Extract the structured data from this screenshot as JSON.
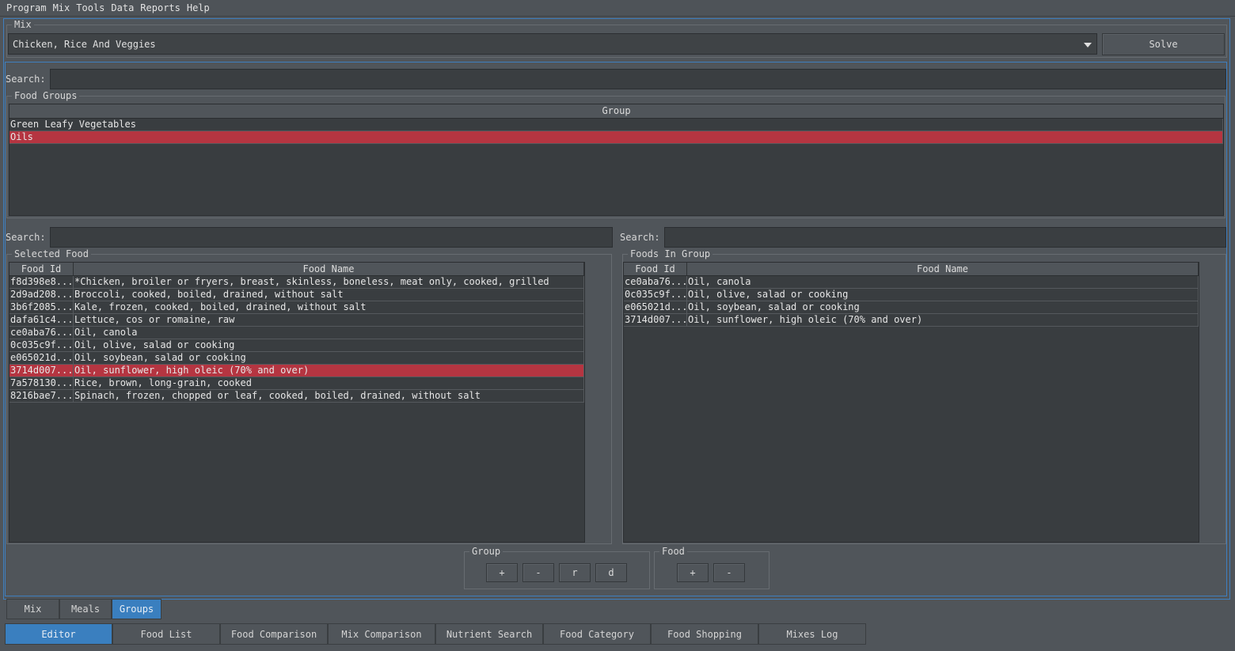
{
  "menu": [
    "Program",
    "Mix",
    "Tools",
    "Data",
    "Reports",
    "Help"
  ],
  "mix": {
    "title": "Mix",
    "selected": "Chicken, Rice And Veggies",
    "solve_label": "Solve"
  },
  "groups_search": {
    "label": "Search:",
    "value": ""
  },
  "food_groups": {
    "title": "Food Groups",
    "column": "Group",
    "rows": [
      "Green Leafy Vegetables",
      "Oils"
    ],
    "selected_index": 1
  },
  "left_search": {
    "label": "Search:",
    "value": ""
  },
  "right_search": {
    "label": "Search:",
    "value": ""
  },
  "selected_food": {
    "title": "Selected Food",
    "columns": [
      "Food Id",
      "Food Name"
    ],
    "rows": [
      [
        "f8d398e8...",
        "*Chicken, broiler or fryers, breast, skinless, boneless, meat only, cooked, grilled"
      ],
      [
        "2d9ad208...",
        "Broccoli, cooked, boiled, drained, without salt"
      ],
      [
        "3b6f2085...",
        "Kale, frozen, cooked, boiled, drained, without salt"
      ],
      [
        "dafa61c4...",
        "Lettuce, cos or romaine, raw"
      ],
      [
        "ce0aba76...",
        "Oil, canola"
      ],
      [
        "0c035c9f...",
        "Oil, olive, salad or cooking"
      ],
      [
        "e065021d...",
        "Oil, soybean, salad or cooking"
      ],
      [
        "3714d007...",
        "Oil, sunflower, high oleic (70% and over)"
      ],
      [
        "7a578130...",
        "Rice, brown, long-grain, cooked"
      ],
      [
        "8216bae7...",
        "Spinach, frozen, chopped or leaf, cooked, boiled, drained, without salt"
      ]
    ],
    "selected_index": 7
  },
  "foods_in_group": {
    "title": "Foods In Group",
    "columns": [
      "Food Id",
      "Food Name"
    ],
    "rows": [
      [
        "ce0aba76...",
        "Oil, canola"
      ],
      [
        "0c035c9f...",
        "Oil, olive, salad or cooking"
      ],
      [
        "e065021d...",
        "Oil, soybean, salad or cooking"
      ],
      [
        "3714d007...",
        "Oil, sunflower, high oleic (70% and over)"
      ]
    ]
  },
  "group_buttons": {
    "title": "Group",
    "add": "+",
    "remove": "-",
    "rename": "r",
    "delete": "d"
  },
  "food_buttons": {
    "title": "Food",
    "add": "+",
    "remove": "-"
  },
  "inner_tabs": [
    "Mix",
    "Meals",
    "Groups"
  ],
  "inner_tab_active": 2,
  "outer_tabs": [
    "Editor",
    "Food List",
    "Food Comparison",
    "Mix Comparison",
    "Nutrient Search",
    "Food Category",
    "Food Shopping",
    "Mixes Log"
  ],
  "outer_tab_active": 0,
  "colors": {
    "selection": "#b53541",
    "accent": "#3a7fbf",
    "background": "#50555a"
  }
}
